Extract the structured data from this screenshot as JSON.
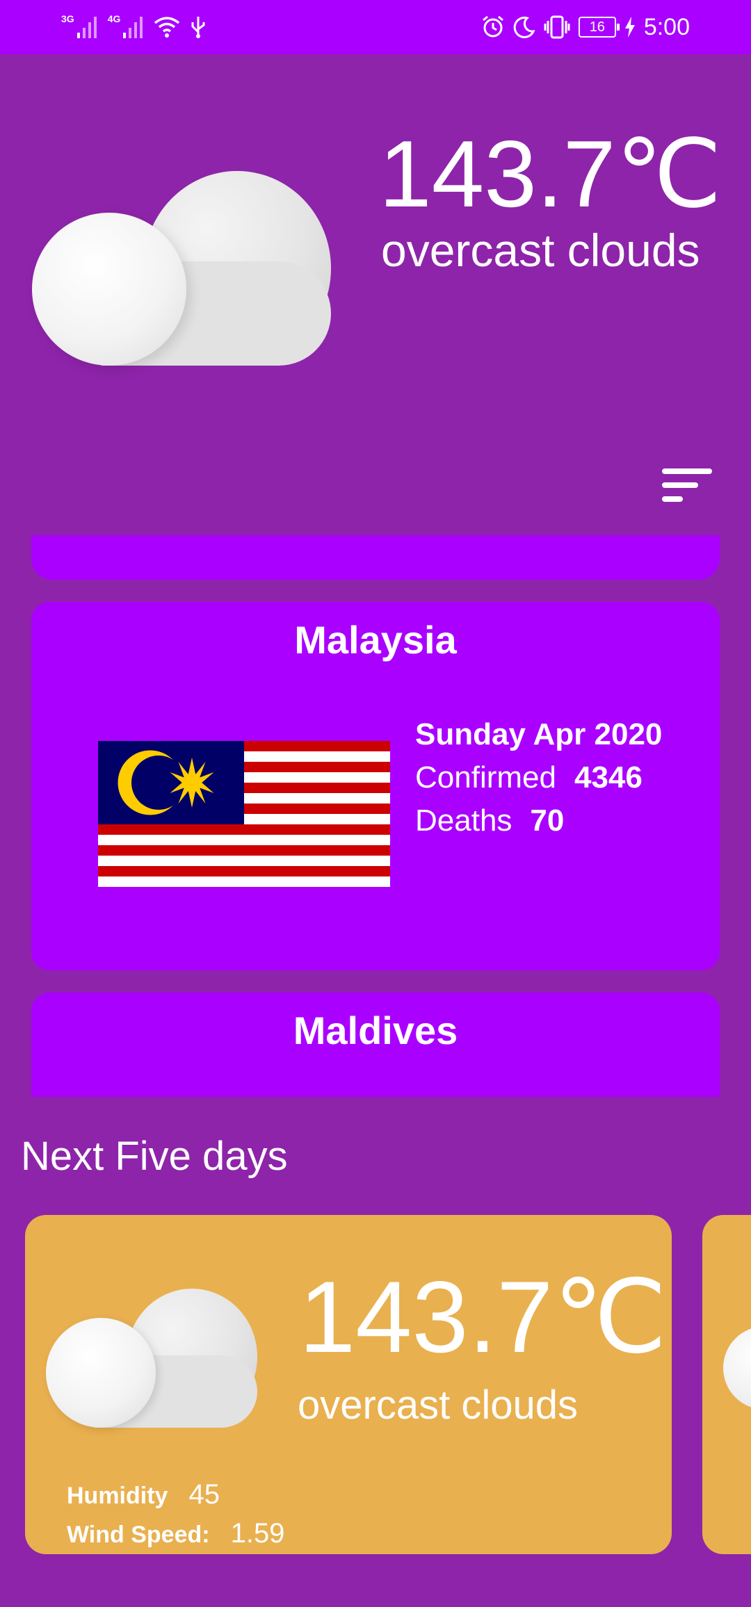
{
  "status_bar": {
    "signal_1_label": "3G",
    "signal_2_label": "4G",
    "battery_level": "16",
    "time": "5:00",
    "icons": [
      "signal-icon",
      "signal-icon",
      "wifi-icon",
      "usb-icon",
      "alarm-icon",
      "moon-icon",
      "vibrate-icon",
      "battery-icon",
      "charging-icon"
    ]
  },
  "current_weather": {
    "temperature": "143.7℃",
    "description": "overcast clouds",
    "icon": "cloud-icon"
  },
  "countries": [
    {
      "name": "Malaysia",
      "date": "Sunday Apr 2020",
      "confirmed_label": "Confirmed",
      "confirmed_value": "4346",
      "deaths_label": "Deaths",
      "deaths_value": "70",
      "flag": "malaysia-flag"
    },
    {
      "name": "Maldives"
    }
  ],
  "forecast": {
    "section_title": "Next Five days",
    "days": [
      {
        "temperature": "143.7℃",
        "description": "overcast clouds",
        "humidity_label": "Humidity",
        "humidity_value": "45",
        "wind_label": "Wind Speed:",
        "wind_value": "1.59"
      }
    ]
  },
  "colors": {
    "background": "#8e24aa",
    "accent": "#aa00ff",
    "forecast_card": "#e9b04f"
  }
}
